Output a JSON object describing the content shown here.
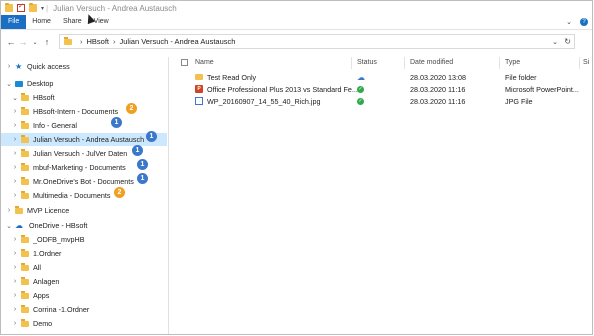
{
  "window": {
    "title": "Julian Versuch - Andrea Austausch"
  },
  "ribbon": {
    "tabs": [
      "File",
      "Home",
      "Share",
      "View"
    ]
  },
  "address": {
    "crumbs": [
      "HBsoft",
      "Julian Versuch - Andrea Austausch"
    ]
  },
  "nav_pane": {
    "quick_access": "Quick access",
    "desktop": "Desktop",
    "hbsoft": "HBsoft",
    "folders": [
      {
        "label": "HBsoft-Intern - Documents",
        "badge": "2",
        "badge_color": "#f0a020"
      },
      {
        "label": "Info - General",
        "badge": "1",
        "badge_color": "#3b78c9"
      },
      {
        "label": "Julian Versuch - Andrea Austausch",
        "badge": "1",
        "badge_color": "#3b78c9"
      },
      {
        "label": "Julian Versuch - JulVer Daten",
        "badge": "1",
        "badge_color": "#3b78c9"
      },
      {
        "label": "mbuf-Marketing - Documents",
        "badge": "1",
        "badge_color": "#3b78c9"
      },
      {
        "label": "Mr.OneDrive's Bot - Documents",
        "badge": "1",
        "badge_color": "#3b78c9"
      },
      {
        "label": "Multimedia - Documents",
        "badge": "2",
        "badge_color": "#f0a020"
      }
    ],
    "mvp": "MVP Licence",
    "onedrive": "OneDrive - HBsoft",
    "onedrive_folders": [
      "_ODFB_mvpHB",
      "1.Ordner",
      "All",
      "Anlagen",
      "Apps",
      "Corrina -1.Ordner",
      "Demo"
    ]
  },
  "columns": {
    "name": "Name",
    "status": "Status",
    "date": "Date modified",
    "type": "Type",
    "size": "Si"
  },
  "files": [
    {
      "name": "Test Read Only",
      "status": "cloud-icon",
      "date": "28.03.2020 13:08",
      "type": "File folder"
    },
    {
      "name": "Office Professional Plus 2013 vs Standard Fe...",
      "status": "synced-icon",
      "date": "28.03.2020 11:16",
      "type": "Microsoft PowerPoint..."
    },
    {
      "name": "WP_20160907_14_55_40_Rich.jpg",
      "status": "synced-icon",
      "date": "28.03.2020 11:16",
      "type": "JPG File"
    }
  ]
}
